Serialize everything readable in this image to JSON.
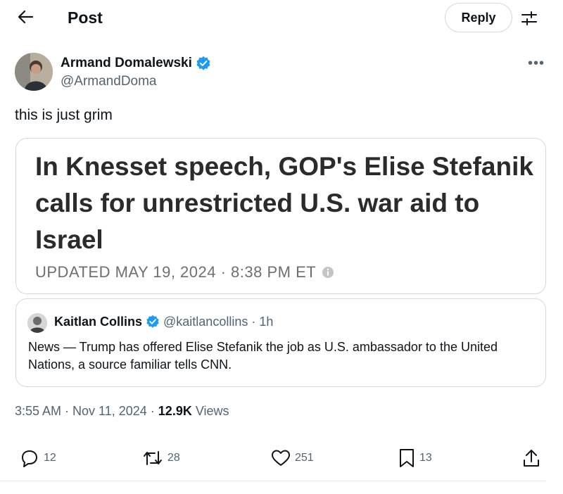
{
  "header": {
    "title": "Post",
    "reply_label": "Reply"
  },
  "author": {
    "name": "Armand Domalewski",
    "handle": "@ArmandDoma",
    "verified": true,
    "more_label": "•••"
  },
  "tweet": {
    "text": "this is just grim"
  },
  "card": {
    "headline": "In Knesset speech, GOP's Elise Stefanik calls for unrestricted U.S. war aid to Israel",
    "updated": "UPDATED MAY 19, 2024 · 8:38 PM ET"
  },
  "quote": {
    "name": "Kaitlan Collins",
    "handle": "@kaitlancollins",
    "time": "· 1h",
    "text": "News — Trump has offered Elise Stefanik the job as U.S. ambassador to the United Nations, a source familiar tells CNN."
  },
  "meta": {
    "time": "3:55 AM",
    "sep1": "·",
    "date": "Nov 11, 2024",
    "sep2": "·",
    "views_count": "12.9K",
    "views_label": "Views"
  },
  "actions": {
    "replies": "12",
    "reposts": "28",
    "likes": "251",
    "bookmarks": "13"
  },
  "colors": {
    "verified": "#1d9bf0",
    "muted": "#536471",
    "border": "#cfd9de"
  },
  "icons": [
    "back-arrow-icon",
    "settings-sliders-icon",
    "verified-badge-icon",
    "info-icon",
    "reply-icon",
    "repost-icon",
    "like-icon",
    "bookmark-icon",
    "share-icon"
  ]
}
